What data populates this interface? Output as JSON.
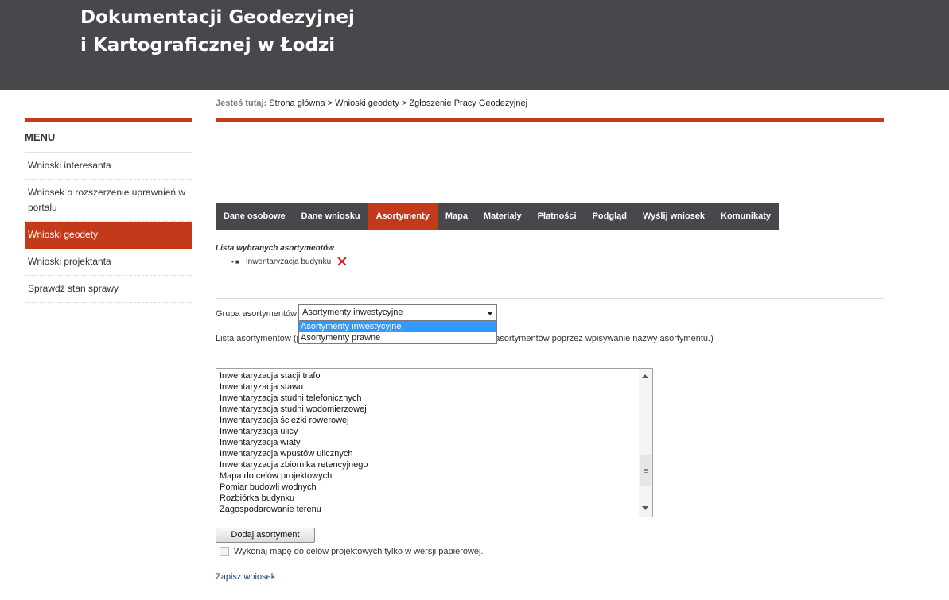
{
  "header": {
    "title_line1": "Dokumentacji Geodezyjnej",
    "title_line2": "i Kartograficznej w Łodzi"
  },
  "breadcrumb": {
    "label": "Jesteś tutaj:",
    "items": [
      "Strona główna",
      "Wnioski geodety",
      "Zgłoszenie Pracy Geodezyjnej"
    ],
    "separator": ">"
  },
  "menu": {
    "title": "MENU",
    "items": [
      {
        "label": "Wnioski interesanta"
      },
      {
        "label": "Wniosek o rozszerzenie uprawnień w portalu"
      },
      {
        "label": "Wnioski geodety"
      },
      {
        "label": "Wnioski projektanta"
      },
      {
        "label": "Sprawdź stan sprawy"
      }
    ],
    "active_index": 2
  },
  "tabs": [
    {
      "label": "Dane osobowe"
    },
    {
      "label": "Dane wniosku"
    },
    {
      "label": "Asortymenty"
    },
    {
      "label": "Mapa"
    },
    {
      "label": "Materiały"
    },
    {
      "label": "Płatności"
    },
    {
      "label": "Podgląd"
    },
    {
      "label": "Wyślij wniosek"
    },
    {
      "label": "Komunikaty"
    }
  ],
  "active_tab": "Asortymenty",
  "selected_assortments": {
    "title": "Lista wybranych asortymentów",
    "items": [
      {
        "label": "Inwentaryzacja budynku",
        "bullet": "• ■"
      }
    ]
  },
  "group": {
    "label": "Grupa asortymentów",
    "selected": "Asortymenty inwestycyjne",
    "options": [
      "Asortymenty inwestycyjne",
      "Asortymenty prawne"
    ]
  },
  "assortment_list": {
    "label_start": "Lista asortymentów (p",
    "label_end": "wać asortymentów poprzez wpisywanie nazwy asortymentu.)",
    "options": [
      "Inwentaryzacja stacji trafo",
      "Inwentaryzacja stawu",
      "Inwentaryzacja studni telefonicznych",
      "Inwentaryzacja studni wodomierzowej",
      "Inwentaryzacja ścieżki rowerowej",
      "Inwentaryzacja ulicy",
      "Inwentaryzacja wiaty",
      "Inwentaryzacja wpustów ulicznych",
      "Inwentaryzacja zbiornika retencyjnego",
      "Mapa do celów projektowych",
      "Pomiar budowli wodnych",
      "Rozbiórka budynku",
      "Zagospodarowanie terenu"
    ]
  },
  "add_button": "Dodaj asortyment",
  "paper_checkbox": {
    "label": "Wykonaj mapę do celów projektowych tylko w wersji papierowej.",
    "checked": false
  },
  "save_link": "Zapisz wniosek",
  "colors": {
    "header_bg": "#47484c",
    "accent": "#c23a1a",
    "highlight": "#3399ff"
  }
}
